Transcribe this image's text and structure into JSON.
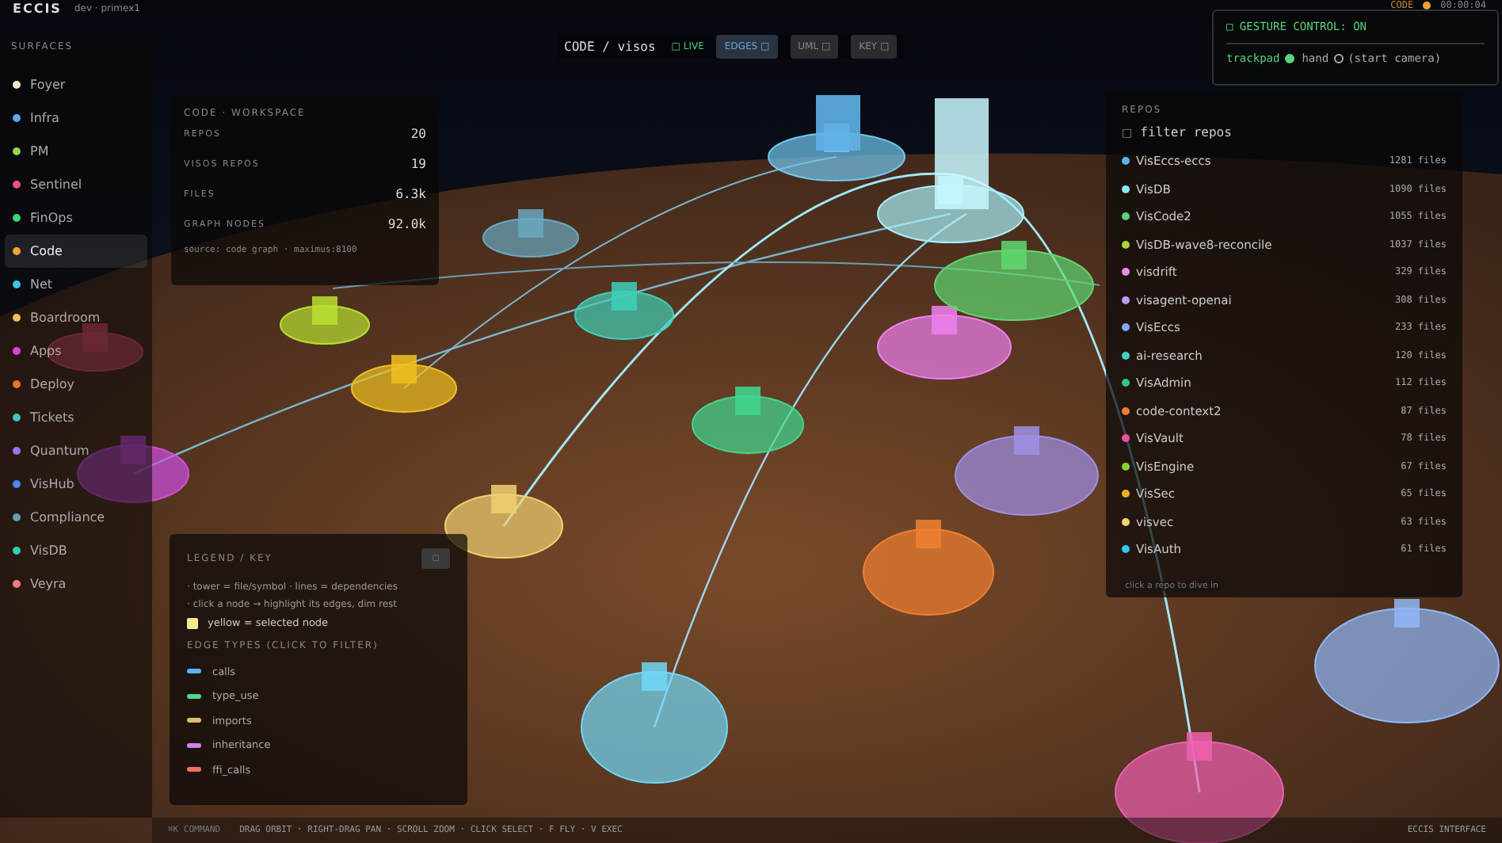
{
  "brand": {
    "name": "ECCIS",
    "env": "dev · primex1"
  },
  "sidebar": {
    "title": "SURFACES",
    "items": [
      {
        "label": "Foyer",
        "color": "#f5e6c8",
        "selected": false
      },
      {
        "label": "Infra",
        "color": "#5aa9f0",
        "selected": false
      },
      {
        "label": "PM",
        "color": "#9ad24a",
        "selected": false
      },
      {
        "label": "Sentinel",
        "color": "#f0507a",
        "selected": false
      },
      {
        "label": "FinOps",
        "color": "#3fd27a",
        "selected": false
      },
      {
        "label": "Code",
        "color": "#f5a23a",
        "selected": true
      },
      {
        "label": "Net",
        "color": "#3fc8e8",
        "selected": false
      },
      {
        "label": "Boardroom",
        "color": "#f0c060",
        "selected": false
      },
      {
        "label": "Apps",
        "color": "#e040e0",
        "selected": false
      },
      {
        "label": "Deploy",
        "color": "#f07030",
        "selected": false
      },
      {
        "label": "Tickets",
        "color": "#3fc8c0",
        "selected": false
      },
      {
        "label": "Quantum",
        "color": "#a070f0",
        "selected": false
      },
      {
        "label": "VisHub",
        "color": "#4a8af0",
        "selected": false
      },
      {
        "label": "Compliance",
        "color": "#60a0b0",
        "selected": false
      },
      {
        "label": "VisDB",
        "color": "#30d0b0",
        "selected": false
      },
      {
        "label": "Veyra",
        "color": "#f08080",
        "selected": false
      }
    ]
  },
  "toolbar": {
    "title": "CODE / visos",
    "live": "□ LIVE",
    "buttons": [
      {
        "label": "EDGES □",
        "selected": true
      },
      {
        "label": "UML □",
        "selected": false
      },
      {
        "label": "KEY □",
        "selected": false
      }
    ]
  },
  "status": {
    "surface": "CODE",
    "time": "00:00:04"
  },
  "gesture": {
    "title": "□ GESTURE CONTROL: ON",
    "options": [
      {
        "label": "trackpad",
        "selected": true
      },
      {
        "label": "hand",
        "selected": false
      }
    ],
    "hint": "(start camera)"
  },
  "workspace": {
    "title": "CODE · WORKSPACE",
    "stats": [
      {
        "label": "REPOS",
        "value": "20"
      },
      {
        "label": "VISOS REPOS",
        "value": "19"
      },
      {
        "label": "FILES",
        "value": "6.3k"
      },
      {
        "label": "GRAPH NODES",
        "value": "92.0k"
      }
    ],
    "source": "source: code graph · maximus:8100"
  },
  "repos": {
    "title": "REPOS",
    "filter_icon": "□",
    "placeholder": "filter repos",
    "items": [
      {
        "name": "VisEccs-eccs",
        "files": "1281 files",
        "color": "#5ab4f0"
      },
      {
        "name": "VisDB",
        "files": "1090 files",
        "color": "#8ee8f0"
      },
      {
        "name": "VisCode2",
        "files": "1055 files",
        "color": "#5ad27a"
      },
      {
        "name": "VisDB-wave8-reconcile",
        "files": "1037 files",
        "color": "#a8d23a"
      },
      {
        "name": "visdrift",
        "files": "329 files",
        "color": "#e890e8"
      },
      {
        "name": "visagent-openai",
        "files": "308 files",
        "color": "#b89af0"
      },
      {
        "name": "VisEccs",
        "files": "233 files",
        "color": "#80a8f0"
      },
      {
        "name": "ai-research",
        "files": "120 files",
        "color": "#40d0c0"
      },
      {
        "name": "VisAdmin",
        "files": "112 files",
        "color": "#30c880"
      },
      {
        "name": "code-context2",
        "files": "87 files",
        "color": "#f08030"
      },
      {
        "name": "VisVault",
        "files": "78 files",
        "color": "#f050a0"
      },
      {
        "name": "VisEngine",
        "files": "67 files",
        "color": "#8ad230"
      },
      {
        "name": "VisSec",
        "files": "65 files",
        "color": "#f0b020"
      },
      {
        "name": "visvec",
        "files": "63 files",
        "color": "#f0d870"
      },
      {
        "name": "VisAuth",
        "files": "61 files",
        "color": "#30c8f0"
      }
    ],
    "footer": "click a repo to dive in"
  },
  "legend": {
    "title": "LEGEND / KEY",
    "toggle": "□",
    "lines": [
      "· tower = file/symbol · lines = dependencies",
      "· click a node → highlight its edges, dim rest"
    ],
    "selected_note": "yellow = selected node",
    "edge_title": "EDGE TYPES (CLICK TO FILTER)",
    "edge_types": [
      {
        "label": "calls",
        "color": "#5ab4f0"
      },
      {
        "label": "type_use",
        "color": "#50d890"
      },
      {
        "label": "imports",
        "color": "#e0c070"
      },
      {
        "label": "inheritance",
        "color": "#d080f0"
      },
      {
        "label": "ffi_calls",
        "color": "#f07060"
      }
    ]
  },
  "bottom_bar": {
    "command": "⌘K COMMAND",
    "hints": "DRAG ORBIT · RIGHT-DRAG PAN · SCROLL ZOOM · CLICK SELECT · F FLY · V EXEC",
    "label": "ECCIS INTERFACE"
  }
}
